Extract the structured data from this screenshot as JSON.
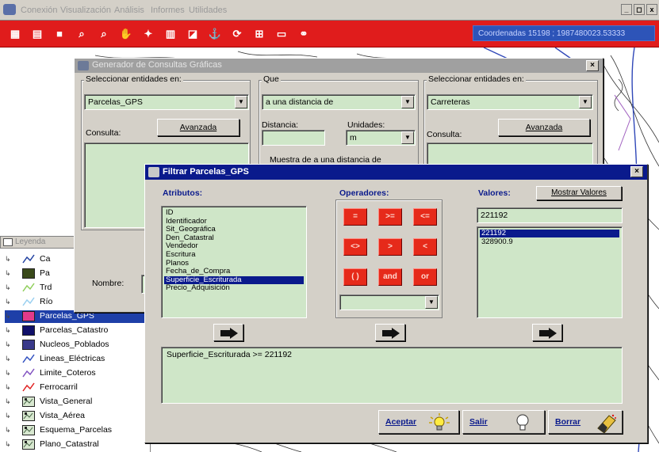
{
  "app": {
    "menu": [
      "Conexión",
      "Visualización",
      "Análisis",
      "Informes",
      "Utilidades"
    ],
    "window_controls": [
      "_",
      "◻",
      "x"
    ],
    "toolbar_icons": [
      "grid-icon",
      "window-icon",
      "stop-icon",
      "zoom-in-icon",
      "zoom-out-icon",
      "pan-icon",
      "select-icon",
      "table-icon",
      "info-icon",
      "measure-icon",
      "refresh-icon",
      "add-layer-icon",
      "scale-icon",
      "link-icon"
    ],
    "coordinates": "Coordenadas 15198 ; 1987480023.53333"
  },
  "legend": {
    "title": "Leyenda",
    "items": [
      {
        "label": "Ca",
        "icon": "line-symbol-icon",
        "color": "#2040a0",
        "selected": false
      },
      {
        "label": "Pa",
        "icon": "fill-symbol-icon",
        "color": "#3a4a1a",
        "selected": false
      },
      {
        "label": "Trd",
        "icon": "line-symbol-icon",
        "color": "#8fcf5a",
        "selected": false
      },
      {
        "label": "Río",
        "icon": "line-symbol-icon",
        "color": "#9ad0f0",
        "selected": false
      },
      {
        "label": "Parcelas_GPS",
        "icon": "fill-symbol-icon",
        "color": "#e23a8a",
        "selected": true
      },
      {
        "label": "Parcelas_Catastro",
        "icon": "fill-symbol-icon",
        "color": "#10106a",
        "selected": false
      },
      {
        "label": "Nucleos_Poblados",
        "icon": "fill-symbol-icon",
        "color": "#3a3a8a",
        "selected": false
      },
      {
        "label": "Lineas_Eléctricas",
        "icon": "line-symbol-icon",
        "color": "#3050c0",
        "selected": false
      },
      {
        "label": "Limite_Coteros",
        "icon": "line-symbol-icon",
        "color": "#8050c0",
        "selected": false
      },
      {
        "label": "Ferrocarril",
        "icon": "line-symbol-icon",
        "color": "#e02020",
        "selected": false
      },
      {
        "label": "Vista_General",
        "icon": "image-layer-icon",
        "color": "#406040",
        "selected": false
      },
      {
        "label": "Vista_Aérea",
        "icon": "image-layer-icon",
        "color": "#406040",
        "selected": false
      },
      {
        "label": "Esquema_Parcelas",
        "icon": "image-layer-icon",
        "color": "#406040",
        "selected": false
      },
      {
        "label": "Plano_Catastral",
        "icon": "image-layer-icon",
        "color": "#406040",
        "selected": false
      }
    ]
  },
  "gen_dialog": {
    "title": "Generador de Consultas Gráficas",
    "left_group": {
      "label": "Seleccionar entidades en:",
      "layer": "Parcelas_GPS",
      "consulta_label": "Consulta:",
      "advanced_button": "Avanzada",
      "nombre_label": "Nombre:"
    },
    "middle_group": {
      "label": "Que",
      "relation": "a una distancia de",
      "distance_label": "Distancia:",
      "distance_value": "",
      "units_label": "Unidades:",
      "units_value": "m",
      "description": "Muestra de a una distancia de"
    },
    "right_group": {
      "label": "Seleccionar entidades en:",
      "layer": "Carreteras",
      "consulta_label": "Consulta:",
      "advanced_button": "Avanzada"
    }
  },
  "filter_dialog": {
    "title": "Filtrar Parcelas_GPS",
    "attributes_label": "Atributos:",
    "attributes": [
      "ID",
      "Identificador",
      "Sit_Geográfica",
      "Den_Catastral",
      "Vendedor",
      "Escritura",
      "Planos",
      "Fecha_de_Compra",
      "Superficie_Escriturada",
      "Precio_Adquisición"
    ],
    "selected_attribute_index": 8,
    "operators_label": "Operadores:",
    "operators": [
      "=",
      ">=",
      "<=",
      "<>",
      ">",
      "<",
      "( )",
      "and",
      "or"
    ],
    "operator_combo_value": "",
    "values_label": "Valores:",
    "show_values_button": "Mostrar Valores",
    "value_field": "221192",
    "values": [
      "221192",
      "328900.9"
    ],
    "selected_value_index": 0,
    "expression": "Superficie_Escriturada >= 221192",
    "accept_button": "Aceptar",
    "exit_button": "Salir",
    "clear_button": "Borrar"
  }
}
